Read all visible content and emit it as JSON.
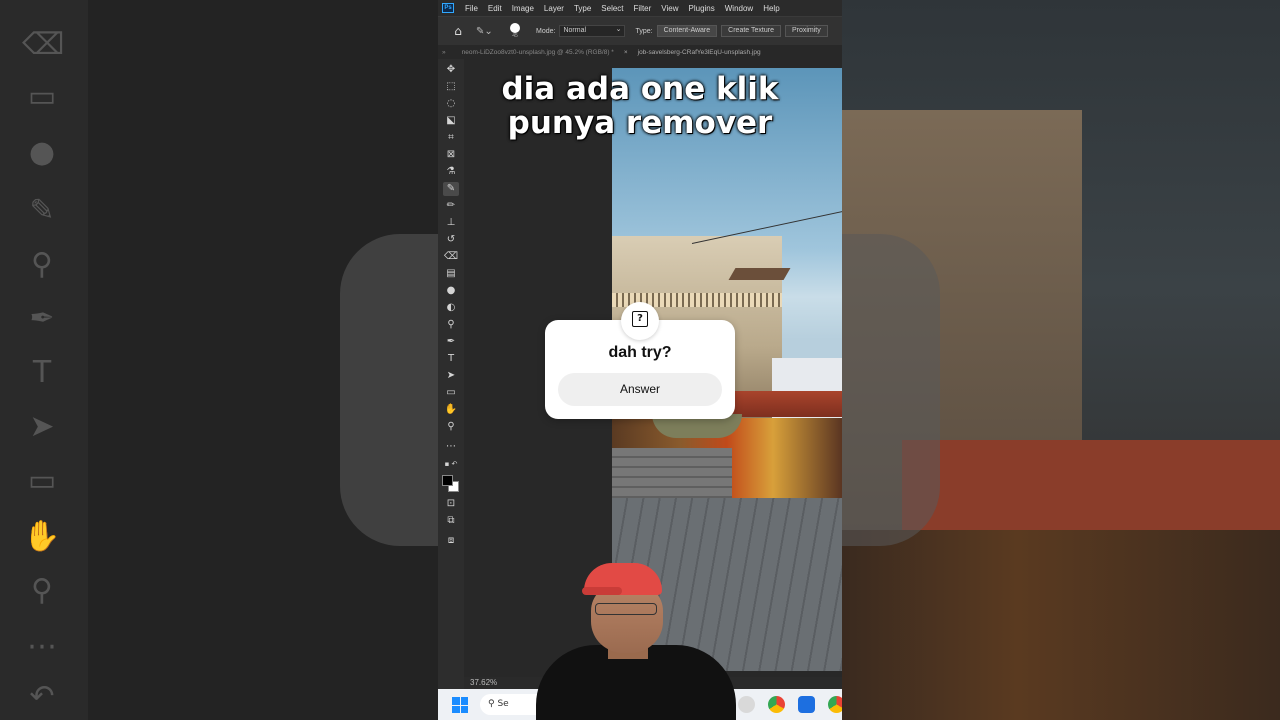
{
  "photoshop": {
    "logo": "Ps",
    "menu": [
      "File",
      "Edit",
      "Image",
      "Layer",
      "Type",
      "Select",
      "Filter",
      "View",
      "Plugins",
      "Window",
      "Help"
    ],
    "options": {
      "brush_size": "45",
      "mode_label": "Mode:",
      "mode_value": "Normal",
      "type_label": "Type:",
      "type_buttons": [
        "Content-Aware",
        "Create Texture",
        "Proximity"
      ]
    },
    "tabs": [
      "neom-LiDZoo8vzt0-unsplash.jpg @ 45.2% (RGB/8) *",
      "job-savelsberg-CRafYe3lEqU-unsplash.jpg"
    ],
    "zoom": "37.62%"
  },
  "overlay": {
    "caption_line1": "dia ada one klik",
    "caption_line2": "punya remover"
  },
  "question": {
    "text": "dah try?",
    "button_label": "Answer"
  },
  "taskbar": {
    "search_placeholder": "Se"
  }
}
